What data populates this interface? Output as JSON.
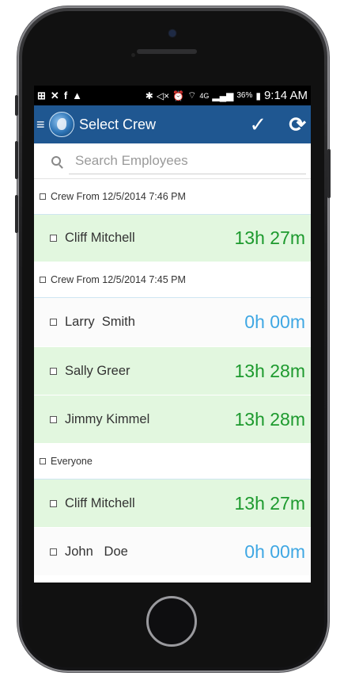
{
  "status_bar": {
    "left_icons": [
      "plus-box-icon",
      "no-call-icon",
      "facebook-icon",
      "warning-icon"
    ],
    "battery": "36%",
    "network": "4G",
    "time": "9:14 AM"
  },
  "app_bar": {
    "title": "Select Crew",
    "actions": [
      "check-icon",
      "refresh-icon"
    ]
  },
  "search": {
    "placeholder": "Search Employees",
    "value": ""
  },
  "colors": {
    "app_bar": "#1f5791",
    "row_green_bg": "#e2f7df",
    "time_green": "#1d9a2e",
    "time_blue": "#3fa7e3"
  },
  "groups": [
    {
      "header": "Crew From 12/5/2014 7:46 PM",
      "employees": [
        {
          "name": "Cliff Mitchell",
          "time": "13h 27m",
          "status": "green"
        }
      ]
    },
    {
      "header": "Crew From 12/5/2014 7:45 PM",
      "employees": [
        {
          "name": "Larry  Smith",
          "time": "0h 00m",
          "status": "blue"
        },
        {
          "name": "Sally Greer",
          "time": "13h 28m",
          "status": "green"
        },
        {
          "name": "Jimmy Kimmel",
          "time": "13h 28m",
          "status": "green"
        }
      ]
    },
    {
      "header": "Everyone",
      "employees": [
        {
          "name": "Cliff Mitchell",
          "time": "13h 27m",
          "status": "green"
        },
        {
          "name": "John   Doe",
          "time": "0h 00m",
          "status": "blue"
        }
      ]
    }
  ]
}
